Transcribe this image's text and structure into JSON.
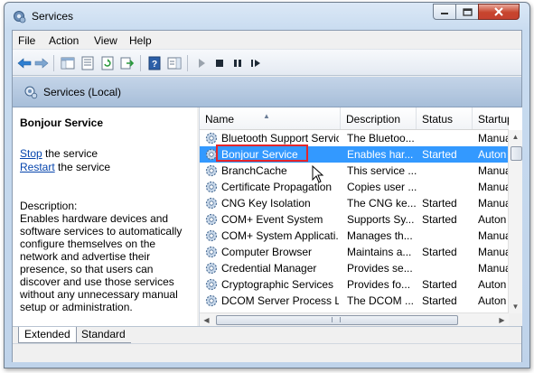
{
  "window": {
    "title": "Services"
  },
  "menu": [
    "File",
    "Action",
    "View",
    "Help"
  ],
  "scope": {
    "label": "Services (Local)"
  },
  "detail": {
    "service_name": "Bonjour Service",
    "stop_link": "Stop",
    "stop_suffix": " the service",
    "restart_link": "Restart",
    "restart_suffix": " the service",
    "description_label": "Description:",
    "description": "Enables hardware devices and software services to automatically configure themselves on the network and advertise their presence, so that users can discover and use those services without any unnecessary manual setup or administration."
  },
  "columns": [
    "Name",
    "Description",
    "Status",
    "Startup"
  ],
  "services": [
    {
      "name": "Bluetooth Support Service",
      "description": "The Bluetoo...",
      "status": "",
      "startup": "Manua"
    },
    {
      "name": "Bonjour Service",
      "description": "Enables har...",
      "status": "Started",
      "startup": "Auton"
    },
    {
      "name": "BranchCache",
      "description": "This service ...",
      "status": "",
      "startup": "Manua"
    },
    {
      "name": "Certificate Propagation",
      "description": "Copies user ...",
      "status": "",
      "startup": "Manua"
    },
    {
      "name": "CNG Key Isolation",
      "description": "The CNG ke...",
      "status": "Started",
      "startup": "Manua"
    },
    {
      "name": "COM+ Event System",
      "description": "Supports Sy...",
      "status": "Started",
      "startup": "Auton"
    },
    {
      "name": "COM+ System Applicati...",
      "description": "Manages th...",
      "status": "",
      "startup": "Manua"
    },
    {
      "name": "Computer Browser",
      "description": "Maintains a...",
      "status": "Started",
      "startup": "Manua"
    },
    {
      "name": "Credential Manager",
      "description": "Provides se...",
      "status": "",
      "startup": "Manua"
    },
    {
      "name": "Cryptographic Services",
      "description": "Provides fo...",
      "status": "Started",
      "startup": "Auton"
    },
    {
      "name": "DCOM Server Process L...",
      "description": "The DCOM ...",
      "status": "Started",
      "startup": "Auton"
    }
  ],
  "selected_index": 1,
  "tabs": [
    "Extended",
    "Standard"
  ],
  "colors": {
    "selection": "#3399ff",
    "highlight_box": "#e5252a",
    "header_band": "#b5c8df"
  }
}
